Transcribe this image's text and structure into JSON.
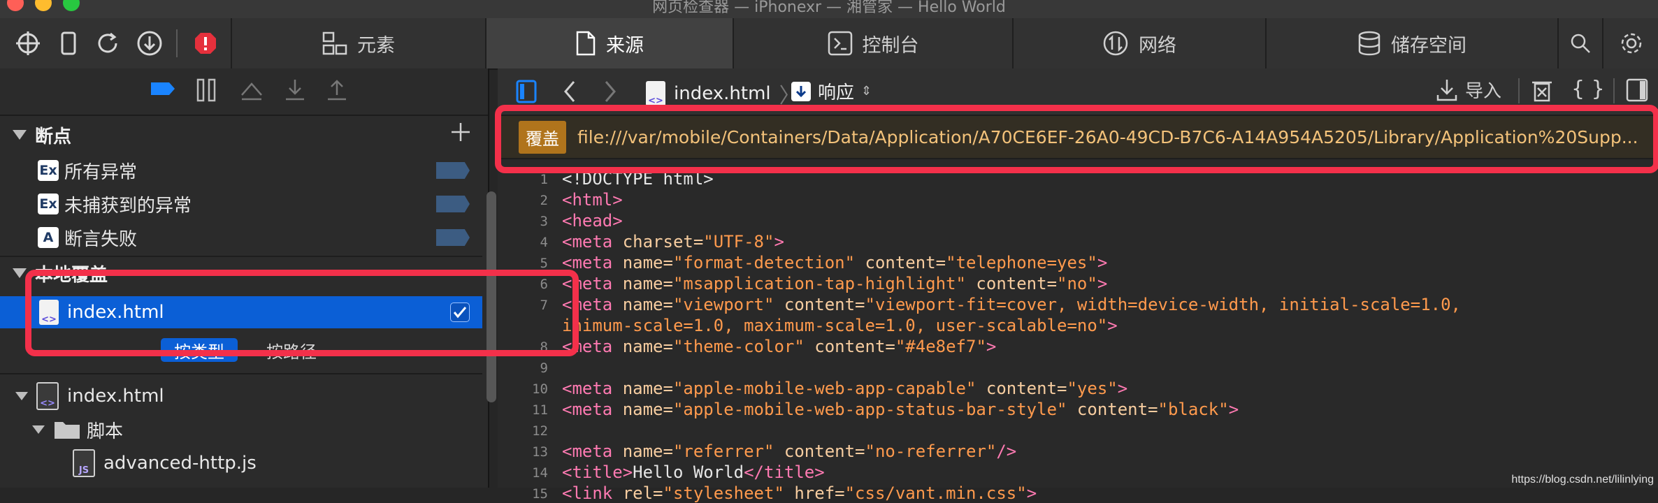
{
  "window": {
    "title": "网页检查器 — iPhonexr — 湘管家 — Hello World"
  },
  "tabs": [
    {
      "label": "元素",
      "icon": "elements-icon"
    },
    {
      "label": "来源",
      "icon": "document-icon",
      "active": true
    },
    {
      "label": "控制台",
      "icon": "console-icon"
    },
    {
      "label": "网络",
      "icon": "network-icon"
    },
    {
      "label": "储存空间",
      "icon": "storage-icon"
    }
  ],
  "sidebar": {
    "breakpoints_header": "断点",
    "breakpoints": [
      {
        "badge": "Ex",
        "label": "所有异常"
      },
      {
        "badge": "Ex",
        "label": "未捕获到的异常"
      },
      {
        "badge": "A",
        "label": "断言失败"
      }
    ],
    "local_override_header": "本地覆盖",
    "override_file": "index.html",
    "group_by": {
      "type": "按类型",
      "path": "按路径"
    },
    "tree": {
      "root": "index.html",
      "folder": "脚本",
      "script": "advanced-http.js",
      "script_badge": "JS"
    }
  },
  "editor": {
    "file_name": "index.html",
    "response_label": "响应",
    "import_label": "导入",
    "override_badge": "覆盖",
    "override_url": "file:///var/mobile/Containers/Data/Application/A70CE6EF-26A0-49CD-B7C6-A14A954A5205/Library/Application%20Supp...",
    "line_numbers": [
      "1",
      "2",
      "3",
      "4",
      "5",
      "6",
      "7",
      "8",
      "9",
      "10",
      "11",
      "12",
      "13",
      "14",
      "15"
    ],
    "code": {
      "l1": "<!DOCTYPE html>",
      "l2": "<html>",
      "l3": "<head>",
      "l4": [
        "<meta ",
        "charset=",
        "\"UTF-8\"",
        ">"
      ],
      "l5": [
        "<meta ",
        "name=",
        "\"format-detection\"",
        " content=",
        "\"telephone=yes\"",
        ">"
      ],
      "l6": [
        "<meta ",
        "name=",
        "\"msapplication-tap-highlight\"",
        " content=",
        "\"no\"",
        ">"
      ],
      "l7a": [
        "<meta ",
        "name=",
        "\"viewport\"",
        " content=",
        "\"viewport-fit=cover, width=device-width, initial-scale=1.0,"
      ],
      "l7b": [
        "inimum-scale=1.0, maximum-scale=1.0, user-scalable=no\"",
        ">"
      ],
      "l8": [
        "<meta ",
        "name=",
        "\"theme-color\"",
        " content=",
        "\"#4e8ef7\"",
        ">"
      ],
      "l10": [
        "<meta ",
        "name=",
        "\"apple-mobile-web-app-capable\"",
        " content=",
        "\"yes\"",
        ">"
      ],
      "l11": [
        "<meta ",
        "name=",
        "\"apple-mobile-web-app-status-bar-style\"",
        " content=",
        "\"black\"",
        ">"
      ],
      "l13": [
        "<meta ",
        "name=",
        "\"referrer\"",
        " content=",
        "\"no-referrer\"",
        "/>"
      ],
      "l14": [
        "<title>",
        "Hello World",
        "</title>"
      ],
      "l15": [
        "<link ",
        "rel=",
        "\"stylesheet\"",
        " href=",
        "\"css/vant.min.css\"",
        ">"
      ]
    }
  },
  "watermark": "https://blog.csdn.net/lilinlying",
  "colors": {
    "highlight": "#f3304a",
    "selection": "#0b5fd6",
    "override_badge": "#b0741c"
  }
}
